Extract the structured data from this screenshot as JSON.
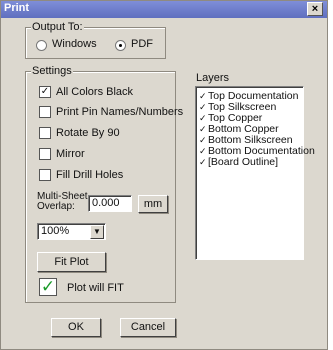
{
  "window": {
    "title": "Print",
    "close_label": "×"
  },
  "output": {
    "legend": "Output To:",
    "options": [
      {
        "label": "Windows",
        "selected": false
      },
      {
        "label": "PDF",
        "selected": true
      }
    ]
  },
  "settings": {
    "legend": "Settings",
    "checks": [
      {
        "label": "All Colors Black",
        "checked": true
      },
      {
        "label": "Print Pin Names/Numbers",
        "checked": false
      },
      {
        "label": "Rotate By 90",
        "checked": false
      },
      {
        "label": "Mirror",
        "checked": false
      },
      {
        "label": "Fill Drill Holes",
        "checked": false
      }
    ],
    "overlap_label_1": "Multi-Sheet",
    "overlap_label_2": "Overlap:",
    "overlap_value": "0.000",
    "unit_button": "mm",
    "zoom_value": "100%",
    "fit_plot_button": "Fit Plot",
    "plot_status": "Plot will FIT",
    "check_mark": "✓"
  },
  "layers": {
    "label": "Layers",
    "items": [
      {
        "label": "Top Documentation",
        "checked": true
      },
      {
        "label": "Top Silkscreen",
        "checked": true
      },
      {
        "label": "Top Copper",
        "checked": true
      },
      {
        "label": "Bottom Copper",
        "checked": true
      },
      {
        "label": "Bottom Silkscreen",
        "checked": true
      },
      {
        "label": "Bottom Documentation",
        "checked": true
      },
      {
        "label": "[Board Outline]",
        "checked": true
      }
    ]
  },
  "buttons": {
    "ok": "OK",
    "cancel": "Cancel"
  }
}
